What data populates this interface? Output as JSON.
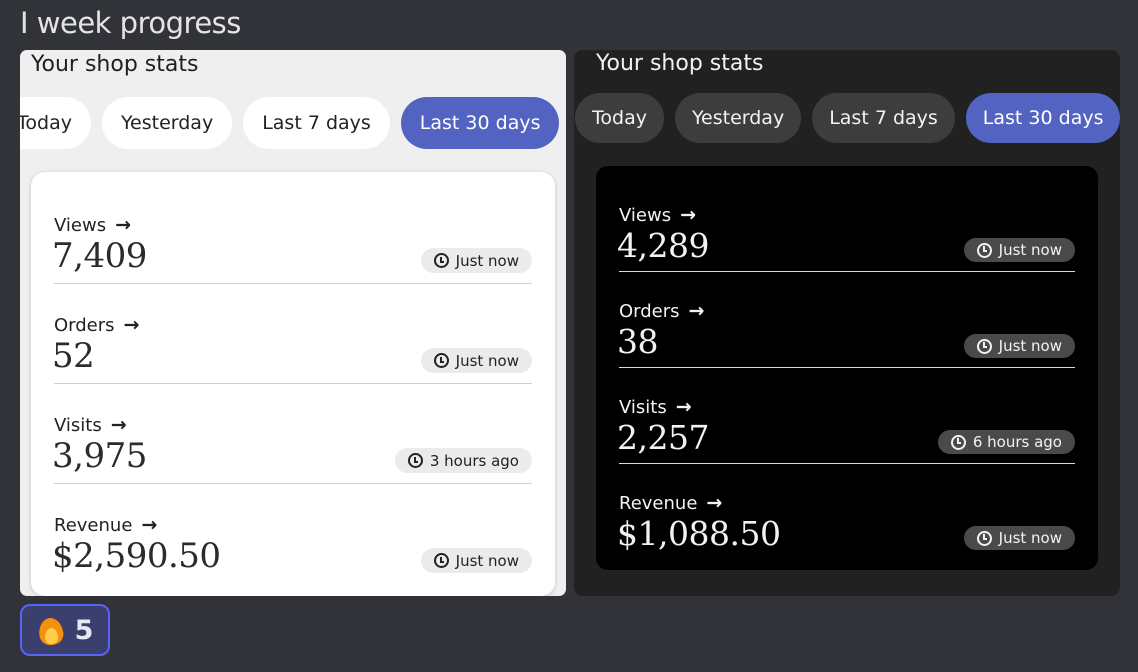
{
  "message": {
    "text": "I week progress"
  },
  "light": {
    "title": "Your shop stats",
    "tabs": [
      "Today",
      "Yesterday",
      "Last 7 days",
      "Last 30 days"
    ],
    "active_tab": "Last 30 days",
    "stats": [
      {
        "label": "Views",
        "value": "7,409",
        "updated": "Just now"
      },
      {
        "label": "Orders",
        "value": "52",
        "updated": "Just now"
      },
      {
        "label": "Visits",
        "value": "3,975",
        "updated": "3 hours ago"
      },
      {
        "label": "Revenue",
        "value": "$2,590.50",
        "updated": "Just now"
      }
    ]
  },
  "dark": {
    "title": "Your shop stats",
    "tabs": [
      "Today",
      "Yesterday",
      "Last 7 days",
      "Last 30 days"
    ],
    "active_tab": "Last 30 days",
    "stats": [
      {
        "label": "Views",
        "value": "4,289",
        "updated": "Just now"
      },
      {
        "label": "Orders",
        "value": "38",
        "updated": "Just now"
      },
      {
        "label": "Visits",
        "value": "2,257",
        "updated": "6 hours ago"
      },
      {
        "label": "Revenue",
        "value": "$1,088.50",
        "updated": "Just now"
      }
    ]
  },
  "reaction": {
    "emoji": "fire",
    "count": "5"
  },
  "colors": {
    "background": "#323339",
    "accent": "#5363c2",
    "reaction_border": "#5865f2"
  }
}
